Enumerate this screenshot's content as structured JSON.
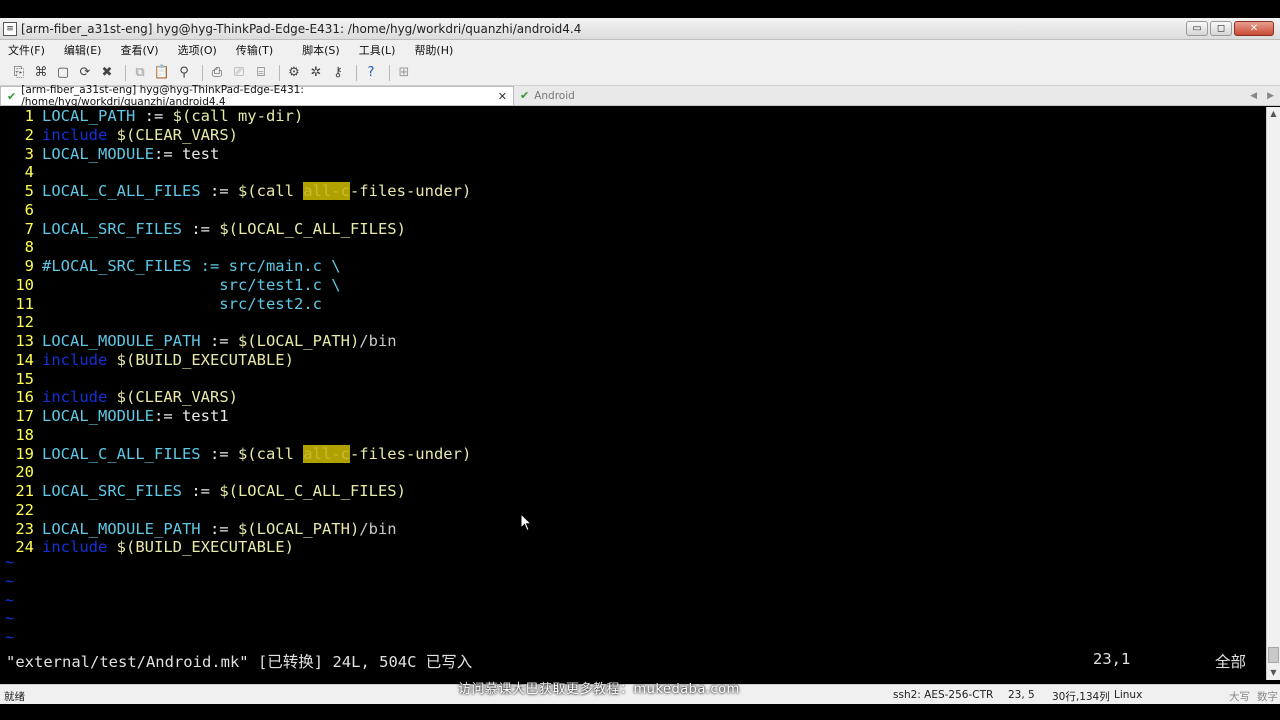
{
  "window": {
    "title": "[arm-fiber_a31st-eng] hyg@hyg-ThinkPad-Edge-E431: /home/hyg/workdri/quanzhi/android4.4",
    "minimize": "▭",
    "maximize": "◻",
    "close": "✕"
  },
  "menu": [
    "文件(F)",
    "编辑(E)",
    "查看(V)",
    "选项(O)",
    "传输(T)",
    "脚本(S)",
    "工具(L)",
    "帮助(H)"
  ],
  "tabs": {
    "active_label": "[arm-fiber_a31st-eng] hyg@hyg-ThinkPad-Edge-E431: /home/hyg/workdri/quanzhi/android4.4",
    "active_close": "✕",
    "inactive_label": "Android",
    "nav_left": "◀",
    "nav_right": "▶"
  },
  "editor": {
    "lines": [
      {
        "num": "1",
        "parts": [
          [
            "var",
            "LOCAL_PATH"
          ],
          [
            "str",
            " := "
          ],
          [
            "mac",
            "$(call my-dir)"
          ]
        ]
      },
      {
        "num": "2",
        "parts": [
          [
            "kw",
            "include"
          ],
          [
            "str",
            " "
          ],
          [
            "mac",
            "$(CLEAR_VARS)"
          ]
        ]
      },
      {
        "num": "3",
        "parts": [
          [
            "var",
            "LOCAL_MODULE"
          ],
          [
            "str",
            ":= test"
          ]
        ]
      },
      {
        "num": "4",
        "parts": []
      },
      {
        "num": "5",
        "parts": [
          [
            "var",
            "LOCAL_C_ALL_FILES"
          ],
          [
            "str",
            " := "
          ],
          [
            "mac",
            "$(call "
          ],
          [
            "hl",
            "all-c"
          ],
          [
            "mac",
            "-files-under)"
          ]
        ]
      },
      {
        "num": "6",
        "parts": []
      },
      {
        "num": "7",
        "parts": [
          [
            "var",
            "LOCAL_SRC_FILES"
          ],
          [
            "str",
            " := "
          ],
          [
            "mac",
            "$(LOCAL_C_ALL_FILES)"
          ]
        ]
      },
      {
        "num": "8",
        "parts": []
      },
      {
        "num": "9",
        "parts": [
          [
            "cmt",
            "#LOCAL_SRC_FILES := src/main.c \\"
          ]
        ]
      },
      {
        "num": "10",
        "parts": [
          [
            "cmt",
            "                   src/test1.c \\"
          ]
        ]
      },
      {
        "num": "11",
        "parts": [
          [
            "cmt",
            "                   src/test2.c"
          ]
        ]
      },
      {
        "num": "12",
        "parts": []
      },
      {
        "num": "13",
        "parts": [
          [
            "var",
            "LOCAL_MODULE_PATH"
          ],
          [
            "str",
            " := "
          ],
          [
            "mac",
            "$(LOCAL_PATH)"
          ],
          [
            "path",
            "/bin"
          ]
        ]
      },
      {
        "num": "14",
        "parts": [
          [
            "kw",
            "include"
          ],
          [
            "str",
            " "
          ],
          [
            "mac",
            "$(BUILD_EXECUTABLE)"
          ]
        ]
      },
      {
        "num": "15",
        "parts": []
      },
      {
        "num": "16",
        "parts": [
          [
            "kw",
            "include"
          ],
          [
            "str",
            " "
          ],
          [
            "mac",
            "$(CLEAR_VARS)"
          ]
        ]
      },
      {
        "num": "17",
        "parts": [
          [
            "var",
            "LOCAL_MODULE"
          ],
          [
            "str",
            ":= test1"
          ]
        ]
      },
      {
        "num": "18",
        "parts": []
      },
      {
        "num": "19",
        "parts": [
          [
            "var",
            "LOCAL_C_ALL_FILES"
          ],
          [
            "str",
            " := "
          ],
          [
            "mac",
            "$(call "
          ],
          [
            "hl",
            "all-c"
          ],
          [
            "mac",
            "-files-under)"
          ]
        ]
      },
      {
        "num": "20",
        "parts": []
      },
      {
        "num": "21",
        "parts": [
          [
            "var",
            "LOCAL_SRC_FILES"
          ],
          [
            "str",
            " := "
          ],
          [
            "mac",
            "$(LOCAL_C_ALL_FILES)"
          ]
        ]
      },
      {
        "num": "22",
        "parts": []
      },
      {
        "num": "23",
        "parts": [
          [
            "var",
            "LOCAL_MODULE_PATH"
          ],
          [
            "str",
            " := "
          ],
          [
            "mac",
            "$(LOCAL_PATH)"
          ],
          [
            "path",
            "/bin"
          ]
        ]
      },
      {
        "num": "24",
        "parts": [
          [
            "kw",
            "include"
          ],
          [
            "str",
            " "
          ],
          [
            "mac",
            "$(BUILD_EXECUTABLE)"
          ]
        ]
      }
    ],
    "tildes": [
      "~",
      "~",
      "~",
      "~",
      "~"
    ]
  },
  "vim_status": {
    "message": "\"external/test/Android.mk\" [已转换] 24L, 504C 已写入",
    "position": "23,1",
    "scroll": "全部"
  },
  "status_bar": {
    "ready": "就绪",
    "cipher": "ssh2: AES-256-CTR",
    "cursor": "23,  5",
    "size": "30行,134列",
    "os": "Linux",
    "caps": "大写",
    "num": "数字"
  },
  "watermark": "访问慕课大巴获取更多教程：mukedaba.com"
}
